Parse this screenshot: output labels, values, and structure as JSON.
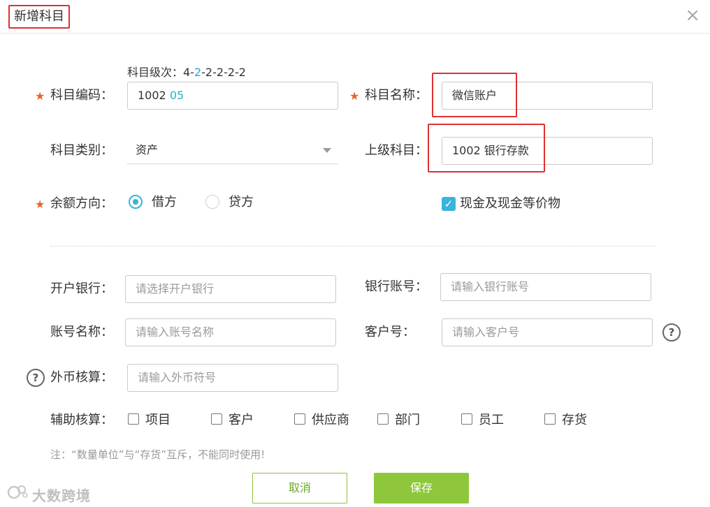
{
  "dialog": {
    "title": "新增科目",
    "close_glyph": "×"
  },
  "form": {
    "code_level_hint_prefix": "科目级次：4-",
    "code_level_hint_highlight": "2",
    "code_level_hint_suffix": "-2-2-2-2",
    "code_label": "科目编码：",
    "code_prefix": "1002 ",
    "code_suffix": "05",
    "name_label": "科目名称：",
    "name_value": "微信账户",
    "category_label": "科目类别：",
    "category_value": "资产",
    "parent_label": "上级科目：",
    "parent_value": "1002 银行存款",
    "balance_label": "余额方向：",
    "debit_label": "借方",
    "credit_label": "贷方",
    "balance_selected": "借方",
    "cash_equiv_label": "现金及现金等价物",
    "cash_equiv_checked": true,
    "check_glyph": "✓"
  },
  "bank": {
    "open_bank_label": "开户银行：",
    "open_bank_placeholder": "请选择开户银行",
    "account_no_label": "银行账号：",
    "account_no_placeholder": "请输入银行账号",
    "account_name_label": "账号名称：",
    "account_name_placeholder": "请输入账号名称",
    "customer_no_label": "客户号：",
    "customer_no_placeholder": "请输入客户号",
    "fx_label": "外币核算：",
    "fx_placeholder": "请输入外币符号",
    "help_glyph": "?"
  },
  "aux": {
    "label": "辅助核算：",
    "items": [
      "项目",
      "客户",
      "供应商",
      "部门",
      "员工",
      "存货"
    ]
  },
  "note": "注：“数量单位”与“存货”互斥，不能同时使用!",
  "buttons": {
    "cancel": "取消",
    "save": "保存"
  },
  "watermark": "大数跨境"
}
